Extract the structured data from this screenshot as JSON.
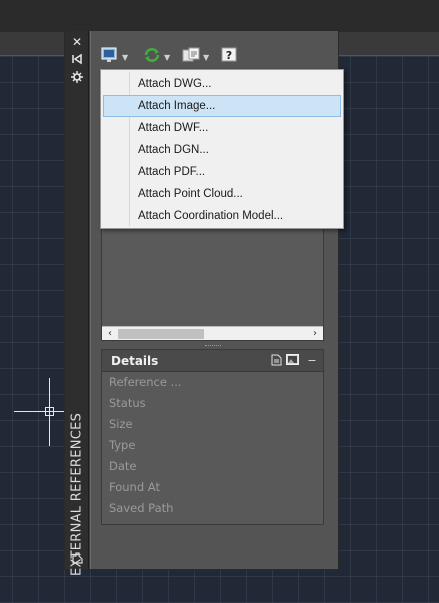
{
  "palette": {
    "title": "EXTERNAL REFERENCES",
    "strip_icons": [
      "close-icon",
      "auto-hide-icon",
      "properties-icon"
    ],
    "toolbar": {
      "buttons": [
        {
          "name": "attach-dwg-dropdown-icon"
        },
        {
          "name": "refresh-icon"
        },
        {
          "name": "change-path-icon"
        },
        {
          "name": "help-icon"
        }
      ]
    }
  },
  "menu": {
    "items": [
      {
        "label": "Attach DWG..."
      },
      {
        "label": "Attach Image...",
        "highlighted": true
      },
      {
        "label": "Attach DWF..."
      },
      {
        "label": "Attach DGN..."
      },
      {
        "label": "Attach PDF..."
      },
      {
        "label": "Attach Point Cloud..."
      },
      {
        "label": "Attach Coordination Model..."
      }
    ]
  },
  "details": {
    "title": "Details",
    "fields": [
      {
        "label": "Reference ..."
      },
      {
        "label": "Status"
      },
      {
        "label": "Size"
      },
      {
        "label": "Type"
      },
      {
        "label": "Date"
      },
      {
        "label": "Found At"
      },
      {
        "label": "Saved Path"
      }
    ]
  },
  "colors": {
    "canvas": "#212836",
    "palette_bg": "#545454",
    "menu_bg": "#f0f0f0",
    "menu_highlight": "#cde4f7"
  }
}
